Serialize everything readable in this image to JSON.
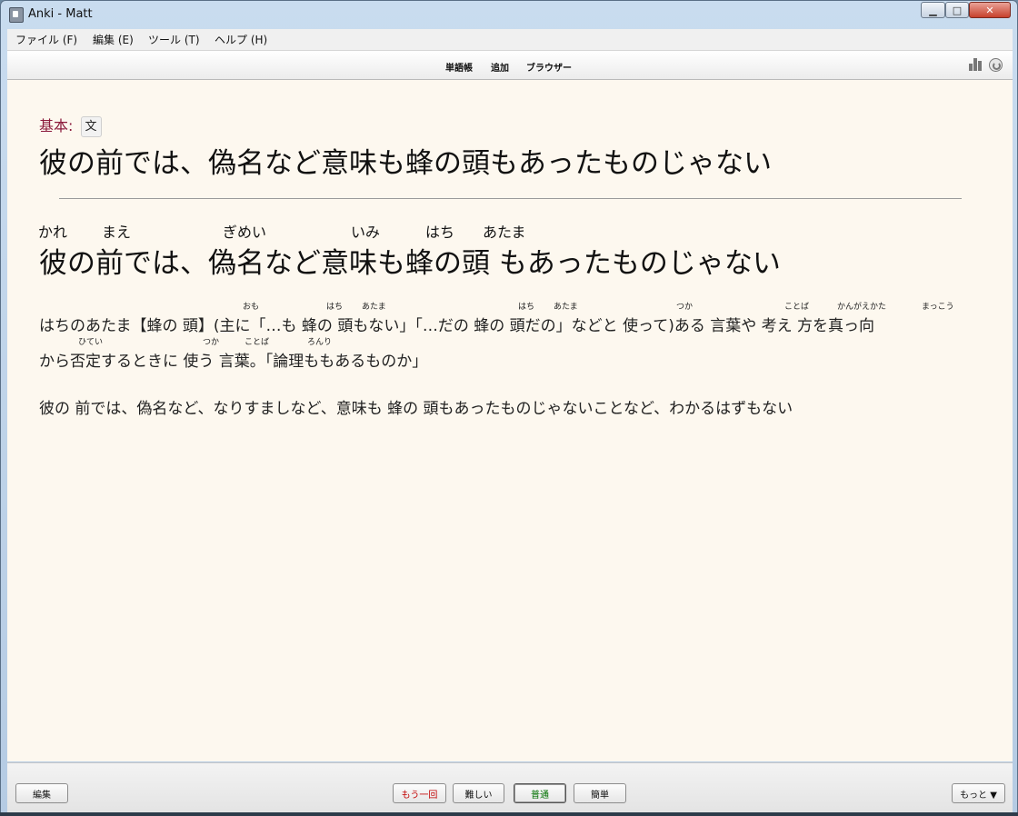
{
  "window": {
    "title": "Anki - Matt",
    "minimize": "▁",
    "maximize": "□",
    "close": "✕"
  },
  "menu": [
    "ファイル (F)",
    "編集 (E)",
    "ツール (T)",
    "ヘルプ (H)"
  ],
  "toolbar": {
    "decks": "単語帳",
    "add": "追加",
    "browse": "ブラウザー",
    "stats_icon": "bar-chart-icon",
    "sync_icon": "sync-icon"
  },
  "card": {
    "note_type": "基本:",
    "edit_tag": "文",
    "front": "彼の前では、偽名など意味も蜂の頭もあったものじゃない",
    "readings": [
      "かれ",
      "まえ",
      "ぎめい",
      "いみ",
      "はち",
      "あたま"
    ],
    "back": "彼の前では、偽名など意味も蜂の頭 もあったものじゃない",
    "definition_line1": "はちのあたま【蜂の 頭】(主に「…も 蜂の 頭もない」「…だの 蜂の 頭だの」などと 使って)ある 言葉や 考え 方を真っ向",
    "definition_line2": "から否定するときに 使う 言葉。「論理ももあるものか」",
    "rubies_line1": [
      "おも",
      "はち",
      "あたま",
      "はち",
      "あたま",
      "つか",
      "ことば",
      "かんがえかた",
      "まっこう"
    ],
    "rubies_line2": [
      "ひてい",
      "つか",
      "ことば",
      "ろんり"
    ],
    "example": "彼の 前では、偽名など、なりすましなど、意味も 蜂の 頭もあったものじゃないことなど、わかるはずもない"
  },
  "buttons": {
    "edit": "編集",
    "again": "もう一回",
    "hard": "難しい",
    "good": "普通",
    "easy": "簡単",
    "more": "もっと ▼"
  },
  "colors": {
    "card_background": "#fdf8ef",
    "note_label": "#8b1a3b",
    "again": "#c00000",
    "good": "#007000"
  }
}
